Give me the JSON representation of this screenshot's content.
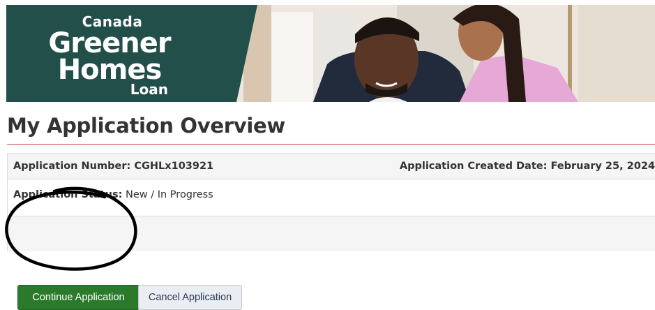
{
  "banner": {
    "logo_line1": "Canada",
    "logo_line2": "Greener",
    "logo_line3": "Homes",
    "logo_line4": "Loan",
    "brand_color": "#234f4a"
  },
  "page": {
    "title": "My Application Overview"
  },
  "application": {
    "number_label": "Application Number:",
    "number_value": "CGHLx103921",
    "created_label": "Application Created Date:",
    "created_value": "February 25, 2024",
    "status_label": "Application Status:",
    "status_value": "New / In Progress"
  },
  "actions": {
    "continue_label": "Continue Application",
    "cancel_label": "Cancel Application",
    "continue_color": "#2b7a2b"
  },
  "annotation": {
    "icon": "hand-drawn-circle"
  }
}
